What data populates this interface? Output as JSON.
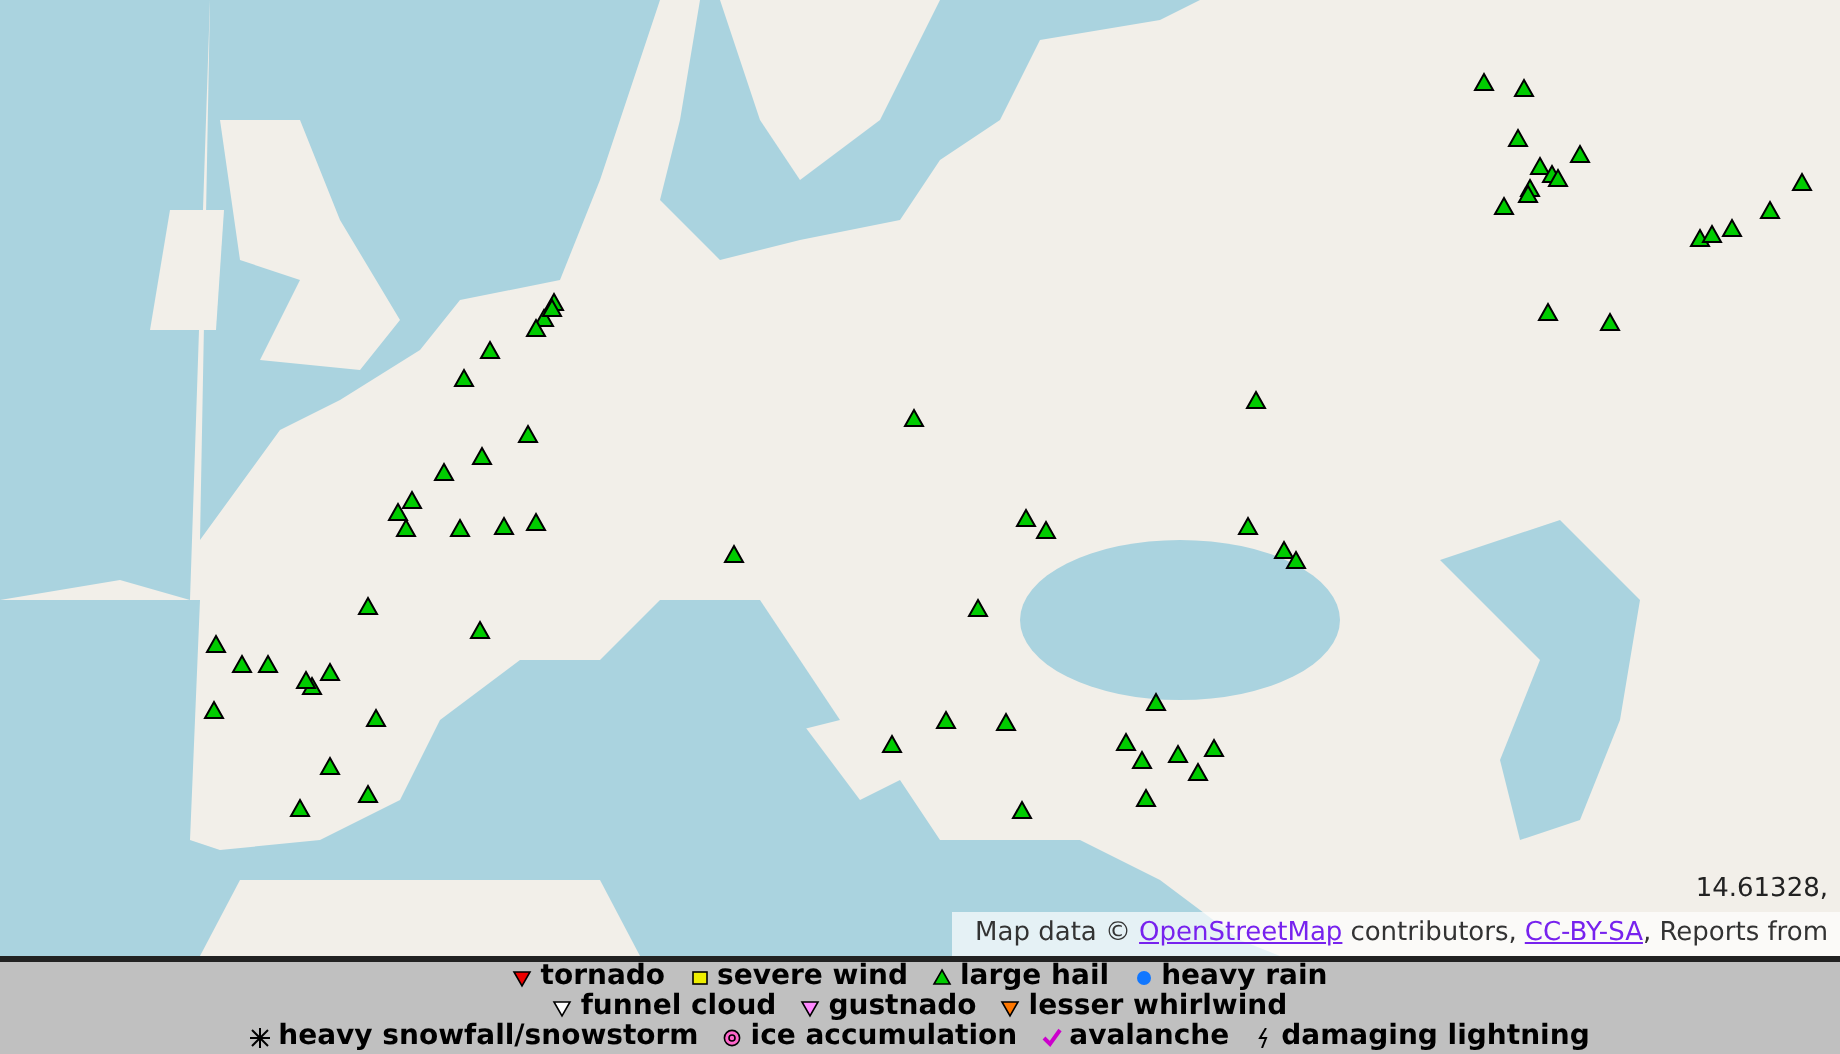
{
  "map": {
    "coordinate": "14.61328,",
    "attribution": [
      {
        "kind": "text",
        "text": "Map data ©"
      },
      {
        "kind": "link",
        "text": "OpenStreetMap"
      },
      {
        "kind": "text",
        "text": "contributors,"
      },
      {
        "kind": "link",
        "text": "CC-BY-SA"
      },
      {
        "kind": "text",
        "text": ", Reports from"
      }
    ]
  },
  "legend": {
    "rows": [
      [
        {
          "kind": "tornado",
          "label": "tornado"
        },
        {
          "kind": "severe_wind",
          "label": "severe wind"
        },
        {
          "kind": "large_hail",
          "label": "large hail"
        },
        {
          "kind": "heavy_rain",
          "label": "heavy rain"
        }
      ],
      [
        {
          "kind": "funnel_cloud",
          "label": "funnel cloud"
        },
        {
          "kind": "gustnado",
          "label": "gustnado"
        },
        {
          "kind": "lesser_whirlwind",
          "label": "lesser whirlwind"
        }
      ],
      [
        {
          "kind": "snowfall",
          "label": "heavy snowfall/snowstorm"
        },
        {
          "kind": "ice",
          "label": "ice accumulation"
        },
        {
          "kind": "avalanche",
          "label": "avalanche"
        },
        {
          "kind": "lightning",
          "label": "damaging lightning"
        }
      ]
    ]
  }
}
